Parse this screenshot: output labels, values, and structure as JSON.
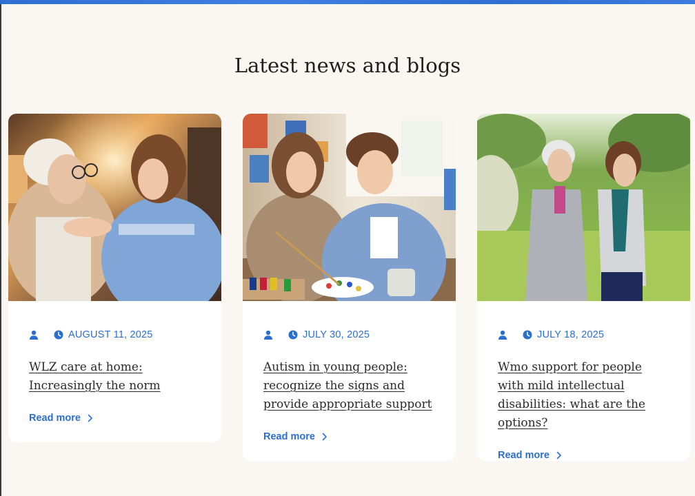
{
  "section": {
    "title": "Latest news and blogs"
  },
  "colors": {
    "accent": "#2a6fcf",
    "background": "#faf7f2",
    "card": "#ffffff",
    "title_text": "#2a2a2a"
  },
  "cards": [
    {
      "image_alt": "Nurse comforting an elderly woman at home",
      "date": "AUGUST 11, 2025",
      "title": "WLZ care at home: Increasingly the norm",
      "read_more": "Read more"
    },
    {
      "image_alt": "Young woman helping a teenage boy with painting",
      "date": "JULY 30, 2025",
      "title": "Autism in young people: recognize the signs and provide appropriate support",
      "read_more": "Read more"
    },
    {
      "image_alt": "Elderly woman walking with a companion in a green field",
      "date": "JULY 18, 2025",
      "title": "Wmo support for people with mild intellectual disabilities: what are the options?",
      "read_more": "Read more"
    }
  ],
  "icons": {
    "author": "user-icon",
    "date": "clock-icon",
    "read_more": "chevron-right-icon"
  }
}
